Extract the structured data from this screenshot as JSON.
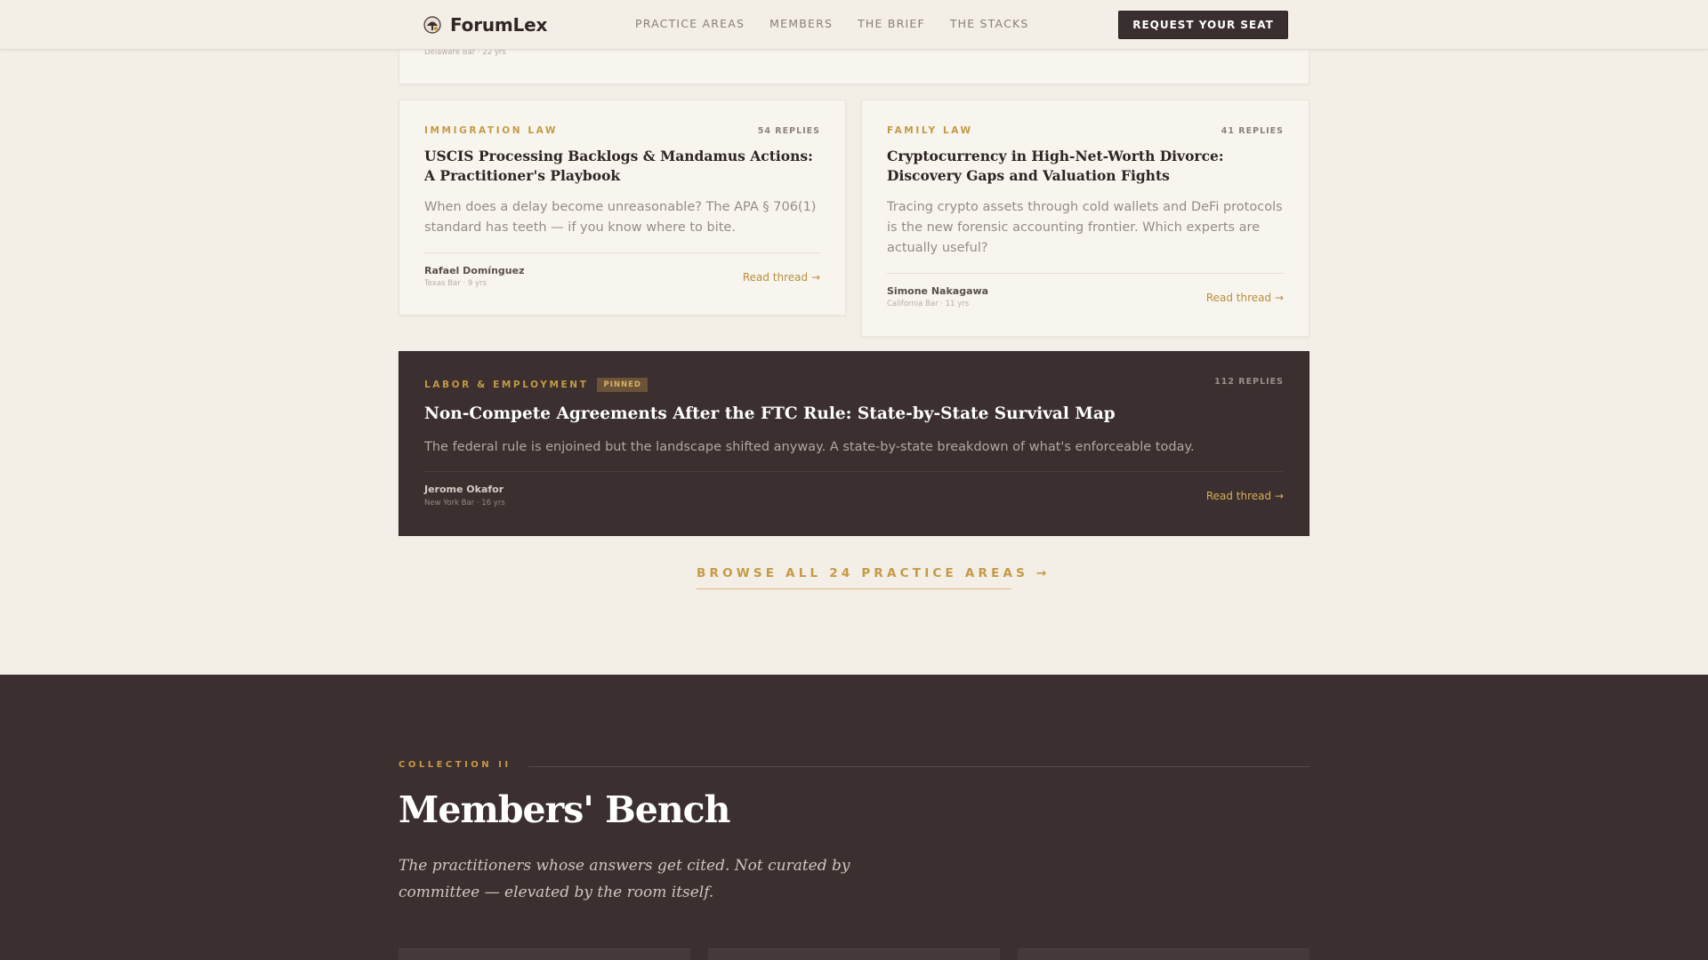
{
  "header": {
    "brand": "ForumLex",
    "nav": [
      "PRACTICE AREAS",
      "MEMBERS",
      "THE BRIEF",
      "THE STACKS"
    ],
    "cta": "REQUEST YOUR SEAT"
  },
  "threads": {
    "top_peek_meta": "Delaware Bar · 22 yrs",
    "left": {
      "category": "IMMIGRATION LAW",
      "replies": "54 REPLIES",
      "title": "USCIS Processing Backlogs & Mandamus Actions: A Practitioner's Playbook",
      "excerpt": "When does a delay become unreasonable? The APA § 706(1) standard has teeth — if you know where to bite.",
      "author": "Rafael Domínguez",
      "author_meta": "Texas Bar · 9 yrs",
      "read": "Read thread →"
    },
    "right": {
      "category": "FAMILY LAW",
      "replies": "41 REPLIES",
      "title": "Cryptocurrency in High-Net-Worth Divorce: Discovery Gaps and Valuation Fights",
      "excerpt": "Tracing crypto assets through cold wallets and DeFi protocols is the new forensic accounting frontier. Which experts are actually useful?",
      "author": "Simone Nakagawa",
      "author_meta": "California Bar · 11 yrs",
      "read": "Read thread →"
    },
    "featured": {
      "category": "LABOR & EMPLOYMENT",
      "badge": "PINNED",
      "replies": "112 REPLIES",
      "title": "Non-Compete Agreements After the FTC Rule: State-by-State Survival Map",
      "excerpt": "The federal rule is enjoined but the landscape shifted anyway. A state-by-state breakdown of what's enforceable today.",
      "author": "Jerome Okafor",
      "author_meta": "New York Bar · 16 yrs",
      "read": "Read thread →"
    },
    "browse": "BROWSE ALL 24 PRACTICE AREAS →"
  },
  "bench": {
    "eyebrow": "COLLECTION II",
    "title": "Members' Bench",
    "lede": "The practitioners whose answers get cited. Not curated by committee — elevated by the room itself."
  },
  "colors": {
    "background": "#f3eee6",
    "accent": "#c49a45",
    "dark": "#3b2f2f"
  }
}
